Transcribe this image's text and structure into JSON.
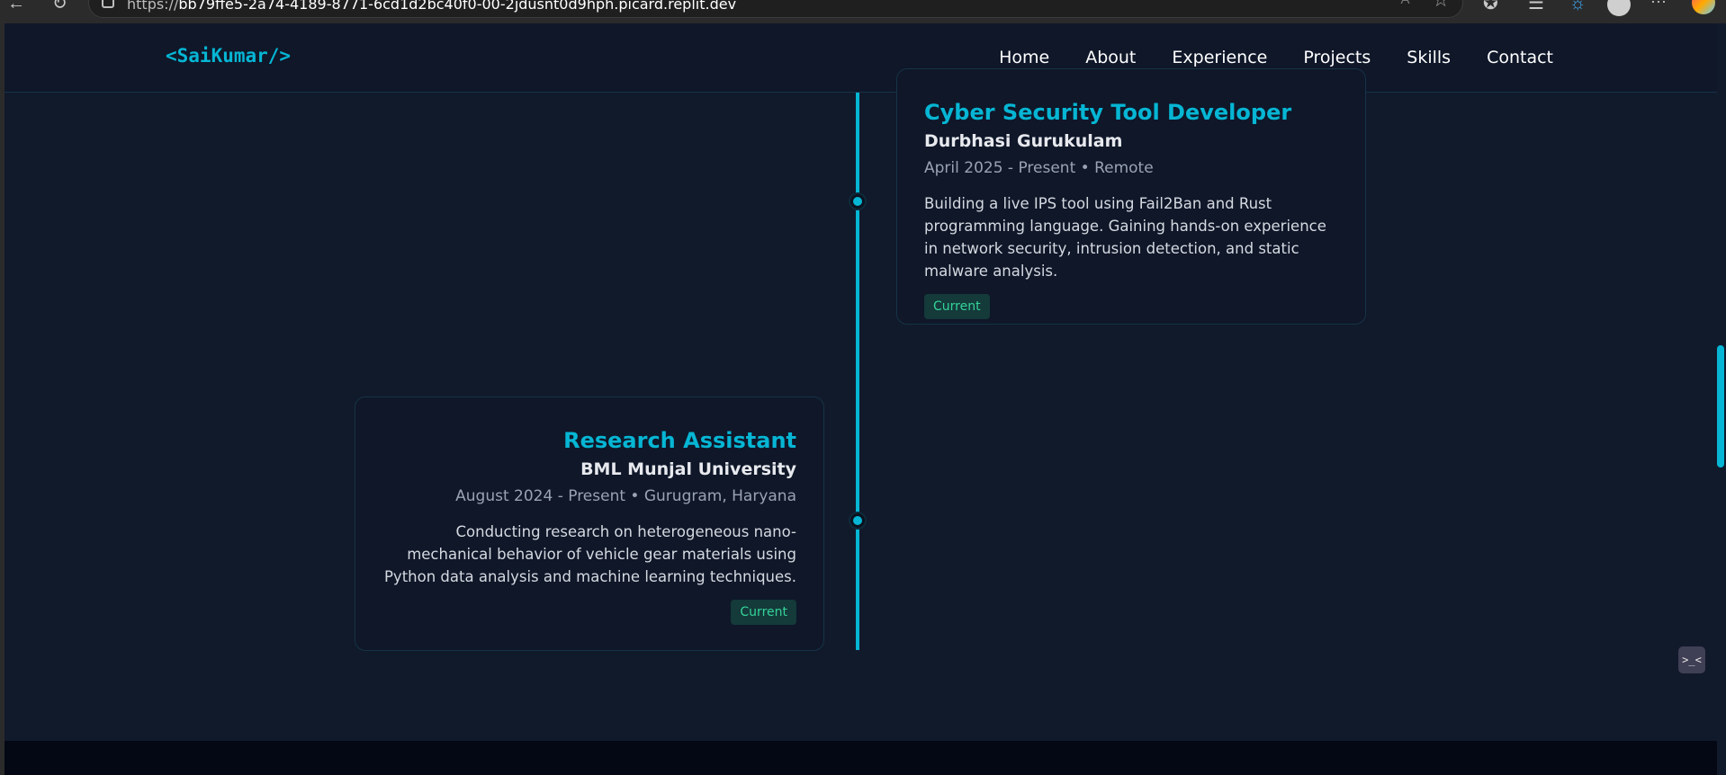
{
  "browser": {
    "url_prefix": "https://",
    "url_rest": "bb79ffe5-2a74-4189-8771-6cd1d2bc40f0-00-2jdusnt0d9hph.picard.replit.dev",
    "read_aloud_icon": "A⁴",
    "favorite_icon": "☆",
    "more_icon": "···"
  },
  "nav": {
    "logo": "<SaiKumar/>",
    "links": [
      "Home",
      "About",
      "Experience",
      "Projects",
      "Skills",
      "Contact"
    ]
  },
  "experience": [
    {
      "title": "Cyber Security Tool Developer",
      "company": "Durbhasi Gurukulam",
      "meta": "April 2025 - Present • Remote",
      "description": "Building a live IPS tool using Fail2Ban and Rust programming language. Gaining hands-on experience in network security, intrusion detection, and static malware analysis.",
      "badge": "Current"
    },
    {
      "title": "Research Assistant",
      "company": "BML Munjal University",
      "meta": "August 2024 - Present • Gurugram, Haryana",
      "description": "Conducting research on heterogeneous nano-mechanical behavior of vehicle gear materials using Python data analysis and machine learning techniques.",
      "badge": "Current"
    }
  ],
  "terminal_icon": ">_<",
  "colors": {
    "accent": "#06b6d4",
    "background": "#111a2b",
    "badge_text": "#34d399"
  }
}
